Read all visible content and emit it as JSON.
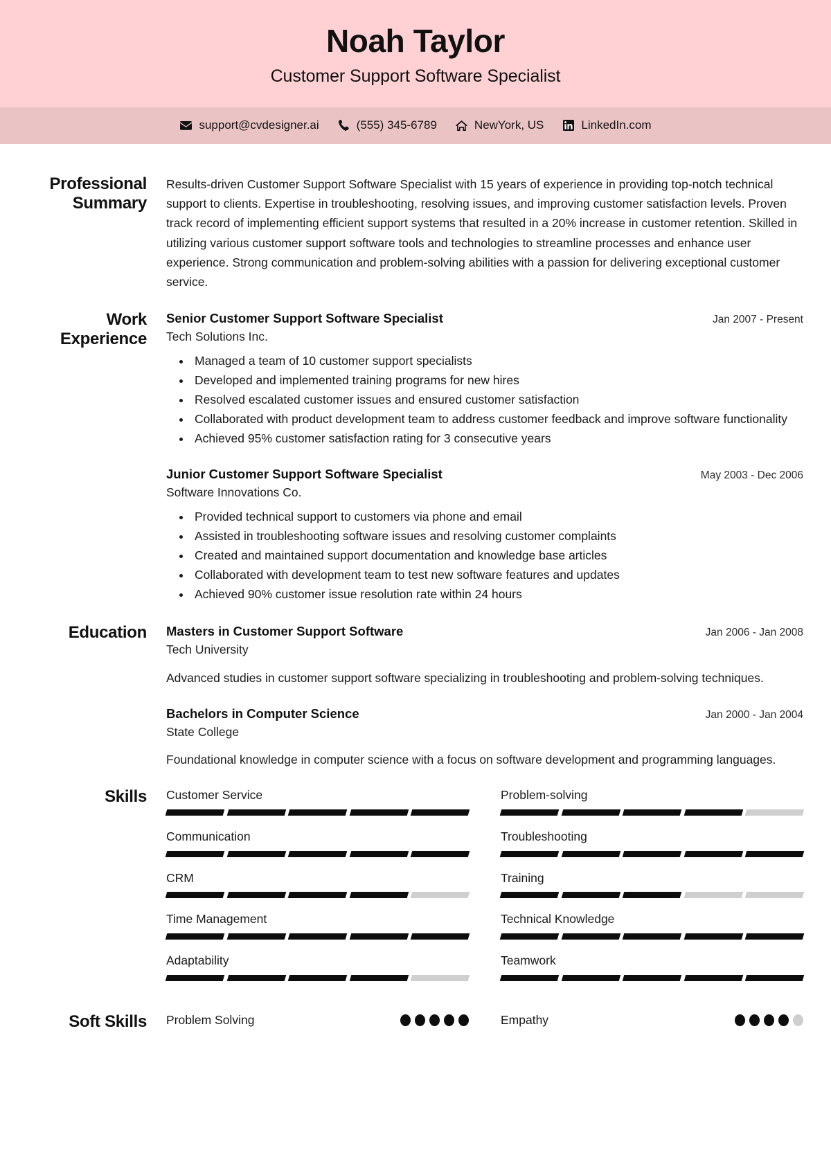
{
  "header": {
    "name": "Noah Taylor",
    "job_title": "Customer Support Software Specialist",
    "bg_color": "#ffd1d4",
    "contact_bg_color": "#eac3c5"
  },
  "contact": {
    "items": [
      {
        "icon": "envelope-icon",
        "text": "support@cvdesigner.ai"
      },
      {
        "icon": "phone-icon",
        "text": "(555) 345-6789"
      },
      {
        "icon": "home-icon",
        "text": "NewYork, US"
      },
      {
        "icon": "linkedin-icon",
        "text": "LinkedIn.com"
      }
    ]
  },
  "sections": {
    "summary": {
      "label": "Professional Summary",
      "text": "Results-driven Customer Support Software Specialist with 15 years of experience in providing top-notch technical support to clients. Expertise in troubleshooting, resolving issues, and improving customer satisfaction levels. Proven track record of implementing efficient support systems that resulted in a 20% increase in customer retention. Skilled in utilizing various customer support software tools and technologies to streamline processes and enhance user experience. Strong communication and problem-solving abilities with a passion for delivering exceptional customer service."
    },
    "work": {
      "label": "Work Experience",
      "entries": [
        {
          "title": "Senior Customer Support Software Specialist",
          "org": "Tech Solutions Inc.",
          "date": "Jan 2007 - Present",
          "bullets": [
            "Managed a team of 10 customer support specialists",
            "Developed and implemented training programs for new hires",
            "Resolved escalated customer issues and ensured customer satisfaction",
            "Collaborated with product development team to address customer feedback and improve software functionality",
            "Achieved 95% customer satisfaction rating for 3 consecutive years"
          ]
        },
        {
          "title": "Junior Customer Support Software Specialist",
          "org": "Software Innovations Co.",
          "date": "May 2003 - Dec 2006",
          "bullets": [
            "Provided technical support to customers via phone and email",
            "Assisted in troubleshooting software issues and resolving customer complaints",
            "Created and maintained support documentation and knowledge base articles",
            "Collaborated with development team to test new software features and updates",
            "Achieved 90% customer issue resolution rate within 24 hours"
          ]
        }
      ]
    },
    "education": {
      "label": "Education",
      "entries": [
        {
          "title": "Masters in Customer Support Software",
          "org": "Tech University",
          "date": "Jan 2006 - Jan 2008",
          "desc": "Advanced studies in customer support software specializing in troubleshooting and problem-solving techniques."
        },
        {
          "title": "Bachelors in Computer Science",
          "org": "State College",
          "date": "Jan 2000 - Jan 2004",
          "desc": "Foundational knowledge in computer science with a focus on software development and programming languages."
        }
      ]
    },
    "skills": {
      "label": "Skills",
      "max_level": 5,
      "items": [
        {
          "name": "Customer Service",
          "level": 5
        },
        {
          "name": "Problem-solving",
          "level": 4
        },
        {
          "name": "Communication",
          "level": 5
        },
        {
          "name": "Troubleshooting",
          "level": 5
        },
        {
          "name": "CRM",
          "level": 4
        },
        {
          "name": "Training",
          "level": 3
        },
        {
          "name": "Time Management",
          "level": 5
        },
        {
          "name": "Technical Knowledge",
          "level": 5
        },
        {
          "name": "Adaptability",
          "level": 4
        },
        {
          "name": "Teamwork",
          "level": 5
        }
      ]
    },
    "soft_skills": {
      "label": "Soft Skills",
      "max_level": 5,
      "items": [
        {
          "name": "Problem Solving",
          "level": 5
        },
        {
          "name": "Empathy",
          "level": 4
        }
      ]
    }
  }
}
